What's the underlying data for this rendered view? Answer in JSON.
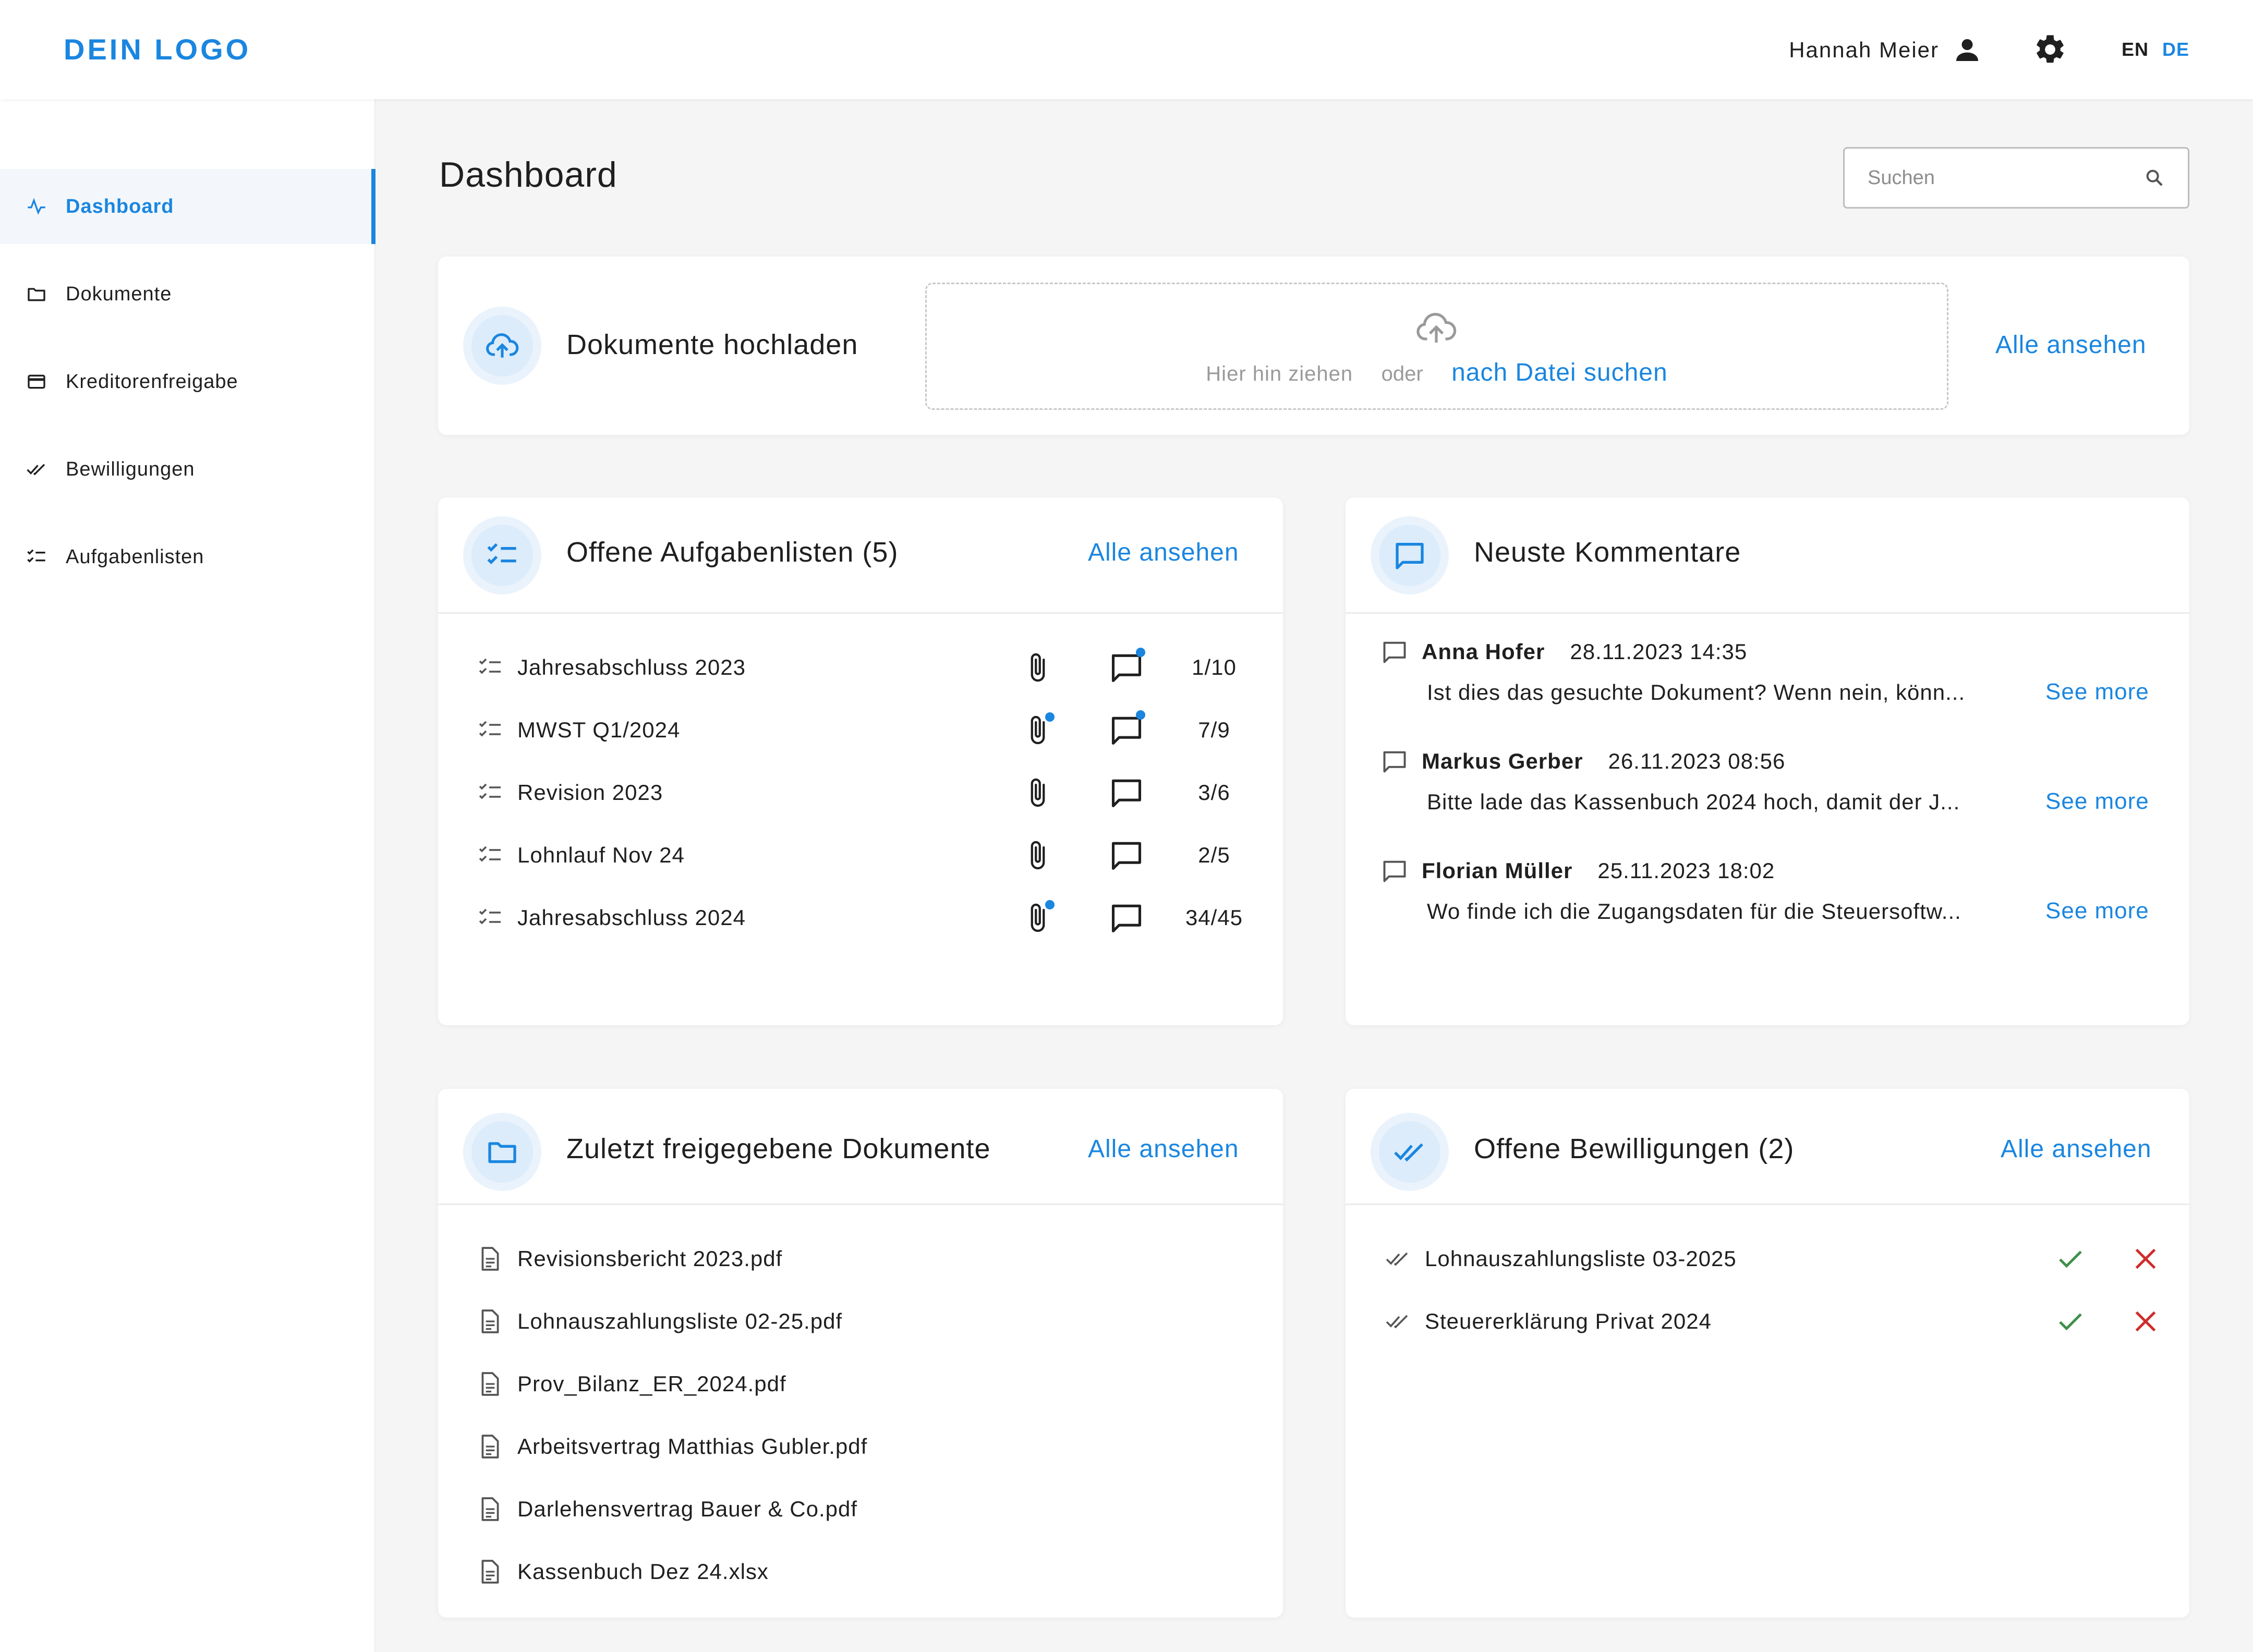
{
  "header": {
    "logo": "DEIN LOGO",
    "user_name": "Hannah Meier",
    "lang_en": "EN",
    "lang_de": "DE"
  },
  "sidebar": {
    "items": [
      {
        "label": "Dashboard",
        "icon": "activity-icon",
        "active": true
      },
      {
        "label": "Dokumente",
        "icon": "folder-icon"
      },
      {
        "label": "Kreditorenfreigabe",
        "icon": "credit-card-icon"
      },
      {
        "label": "Bewilligungen",
        "icon": "double-check-icon"
      },
      {
        "label": "Aufgabenlisten",
        "icon": "checklist-icon"
      }
    ]
  },
  "main": {
    "title": "Dashboard",
    "search_placeholder": "Suchen"
  },
  "upload": {
    "title": "Dokumente hochladen",
    "drag_text": "Hier hin ziehen",
    "or_text": "oder",
    "browse_text": "nach Datei suchen",
    "view_all": "Alle ansehen"
  },
  "tasks": {
    "title": "Offene Aufgabenlisten (5)",
    "view_all": "Alle ansehen",
    "items": [
      {
        "name": "Jahresabschluss 2023",
        "progress": "1/10",
        "attachment_badge": false,
        "comment_badge": true
      },
      {
        "name": "MWST Q1/2024",
        "progress": "7/9",
        "attachment_badge": true,
        "comment_badge": true
      },
      {
        "name": "Revision 2023",
        "progress": "3/6",
        "attachment_badge": false,
        "comment_badge": false
      },
      {
        "name": "Lohnlauf Nov 24",
        "progress": "2/5",
        "attachment_badge": false,
        "comment_badge": false
      },
      {
        "name": "Jahresabschluss 2024",
        "progress": "34/45",
        "attachment_badge": true,
        "comment_badge": false
      }
    ]
  },
  "comments": {
    "title": "Neuste Kommentare",
    "see_more": "See more",
    "items": [
      {
        "author": "Anna Hofer",
        "date": "28.11.2023 14:35",
        "text": "Ist dies das gesuchte Dokument? Wenn nein, könn..."
      },
      {
        "author": "Markus Gerber",
        "date": "26.11.2023 08:56",
        "text": "Bitte lade das Kassenbuch 2024 hoch, damit der J..."
      },
      {
        "author": "Florian Müller",
        "date": "25.11.2023 18:02",
        "text": "Wo finde ich die Zugangsdaten für die Steuersoftw..."
      }
    ]
  },
  "documents": {
    "title": "Zuletzt freigegebene Dokumente",
    "view_all": "Alle ansehen",
    "items": [
      "Revisionsbericht 2023.pdf",
      "Lohnauszahlungsliste 02-25.pdf",
      "Prov_Bilanz_ER_2024.pdf",
      "Arbeitsvertrag Matthias Gubler.pdf",
      "Darlehensvertrag Bauer & Co.pdf",
      "Kassenbuch Dez 24.xlsx"
    ]
  },
  "approvals": {
    "title": "Offene Bewilligungen (2)",
    "view_all": "Alle ansehen",
    "items": [
      "Lohnauszahlungsliste 03-2025",
      "Steuererklärung Privat 2024"
    ]
  },
  "colors": {
    "accent": "#1a86e0",
    "approve": "#3f8f4a",
    "reject": "#d02b2b",
    "badge": "#1a86e0"
  }
}
